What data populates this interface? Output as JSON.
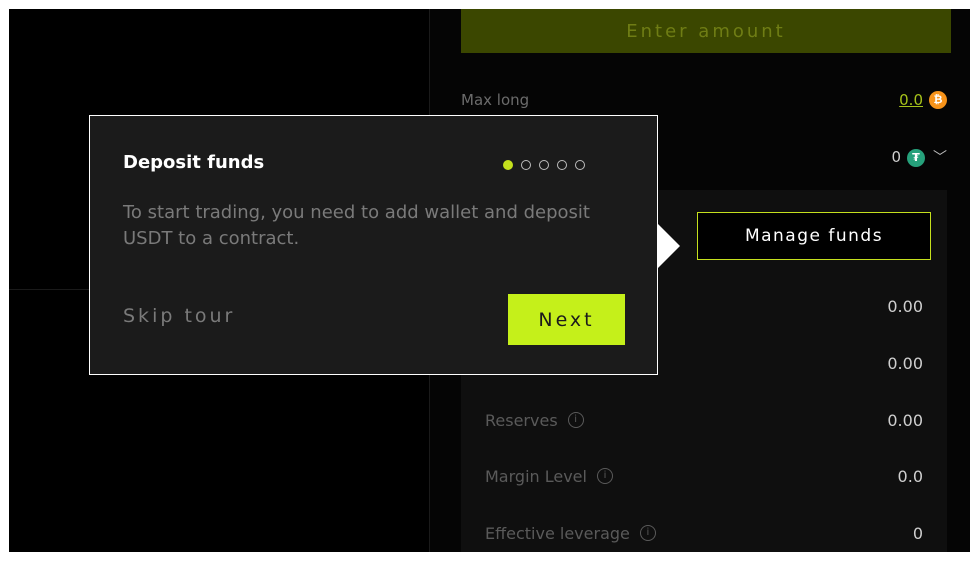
{
  "colors": {
    "accent": "#c5f01a",
    "input_bg": "#3b4700",
    "popover_bg": "#1b1b1b",
    "panel_bg": "#0f0f0f"
  },
  "order_form": {
    "amount_placeholder": "Enter amount",
    "max_long_label": "Max long",
    "max_long_value": "0.0",
    "max_long_coin_icon": "bitcoin-icon",
    "balance_value": "0",
    "balance_coin_icon": "usdt-icon"
  },
  "manage_funds": {
    "label": "Manage funds"
  },
  "stats": {
    "rows": [
      {
        "label": "",
        "value": "0.00"
      },
      {
        "label": "",
        "value": "0.00"
      },
      {
        "label": "Reserves",
        "value": "0.00"
      },
      {
        "label": "Margin Level",
        "value": "0.0"
      },
      {
        "label": "Effective leverage",
        "value": "0"
      }
    ]
  },
  "tour": {
    "title": "Deposit funds",
    "step": 1,
    "total_steps": 5,
    "body": "To start trading, you need to add wallet and deposit USDT to a contract.",
    "skip_label": "Skip tour",
    "next_label": "Next"
  }
}
